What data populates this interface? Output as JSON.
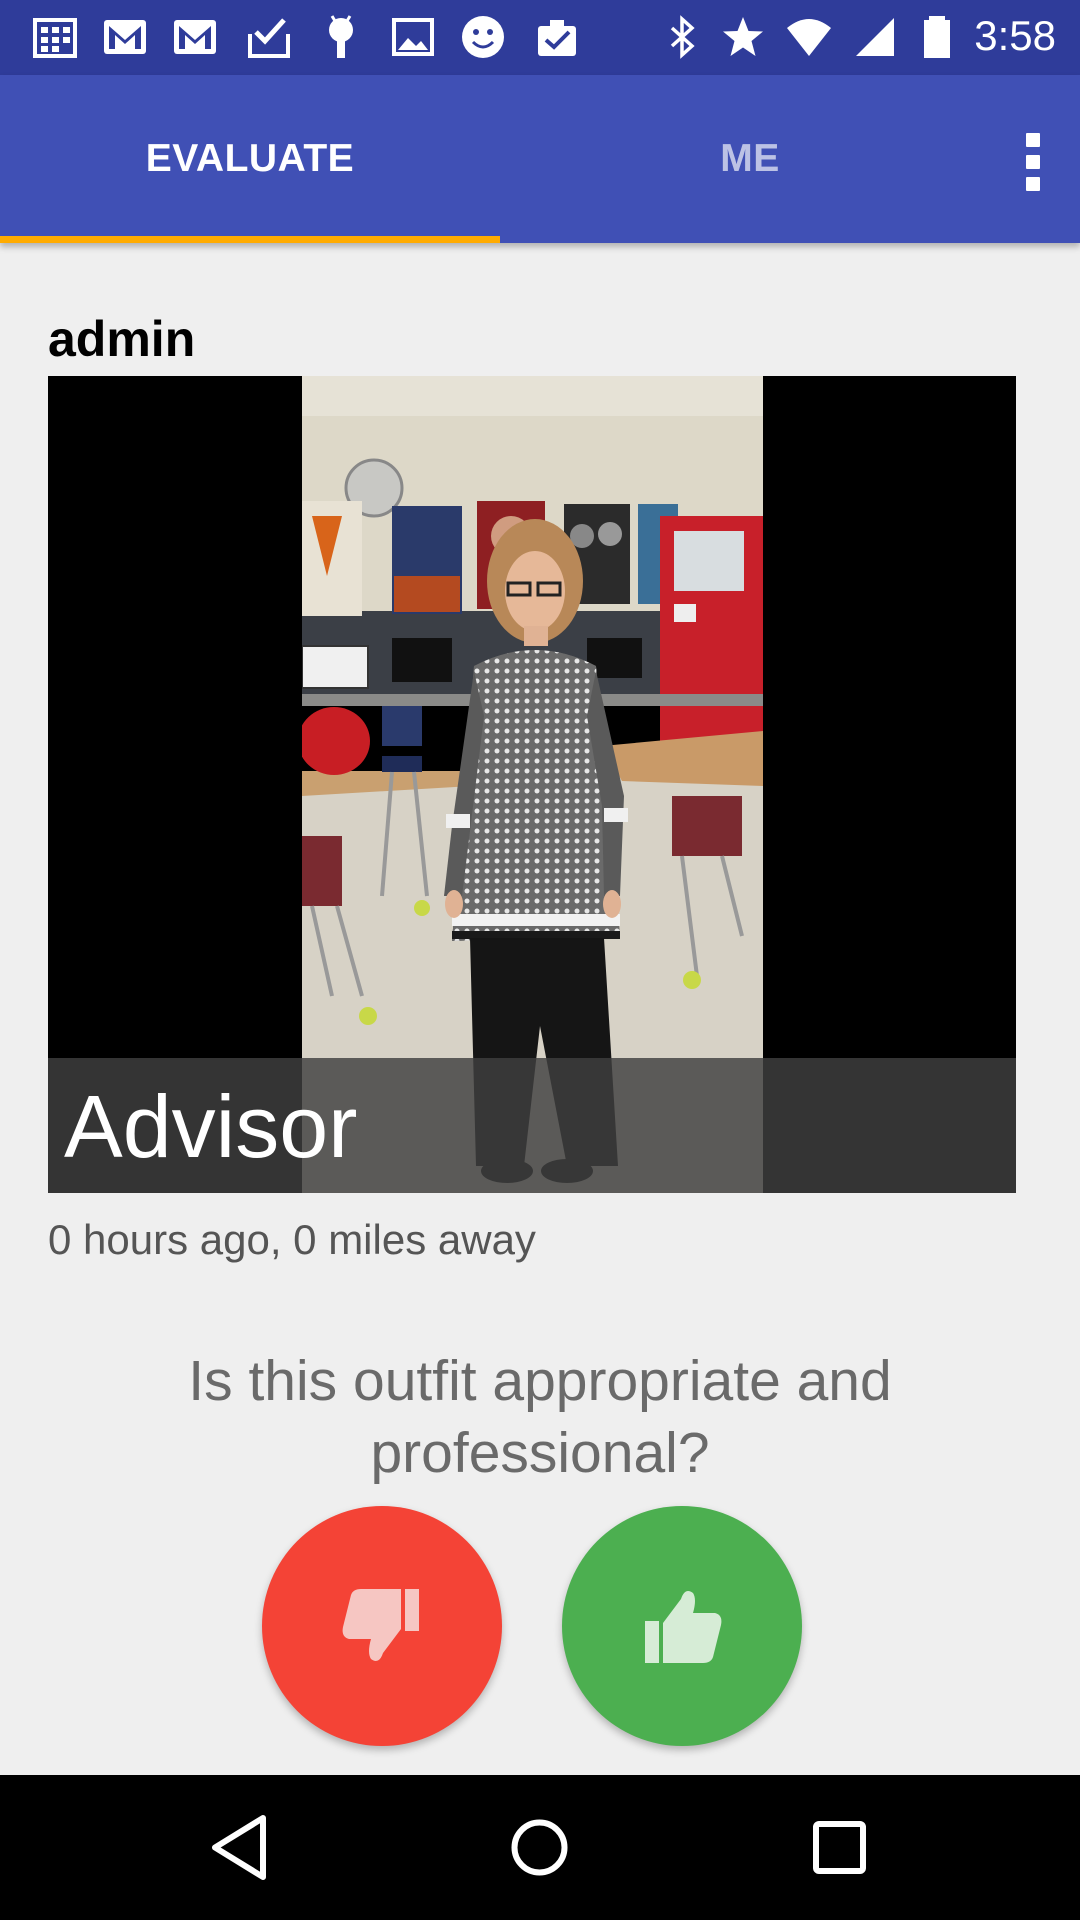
{
  "status_bar": {
    "time": "3:58",
    "icons": [
      "calendar-icon",
      "gmail-icon",
      "gmail-icon",
      "checkbox-icon",
      "android-icon",
      "image-icon",
      "smiley-icon",
      "clipboard-check-icon",
      "bluetooth-icon",
      "star-icon",
      "wifi-icon",
      "signal-icon",
      "battery-icon"
    ]
  },
  "tabs": {
    "evaluate_label": "EVALUATE",
    "me_label": "ME",
    "active": "EVALUATE"
  },
  "post": {
    "author": "admin",
    "caption": "Advisor",
    "meta": "0 hours ago, 0 miles away",
    "question": "Is this outfit appropriate and professional?"
  },
  "actions": {
    "dislike_icon": "thumbs-down-icon",
    "like_icon": "thumbs-up-icon"
  },
  "nav_bar": {
    "icons": [
      "back-icon",
      "home-icon",
      "recents-icon"
    ]
  },
  "colors": {
    "status_bar": "#2f3c9a",
    "app_bar": "#4050b5",
    "tab_indicator": "#ffab00",
    "dislike": "#f44336",
    "like": "#4caf50"
  }
}
